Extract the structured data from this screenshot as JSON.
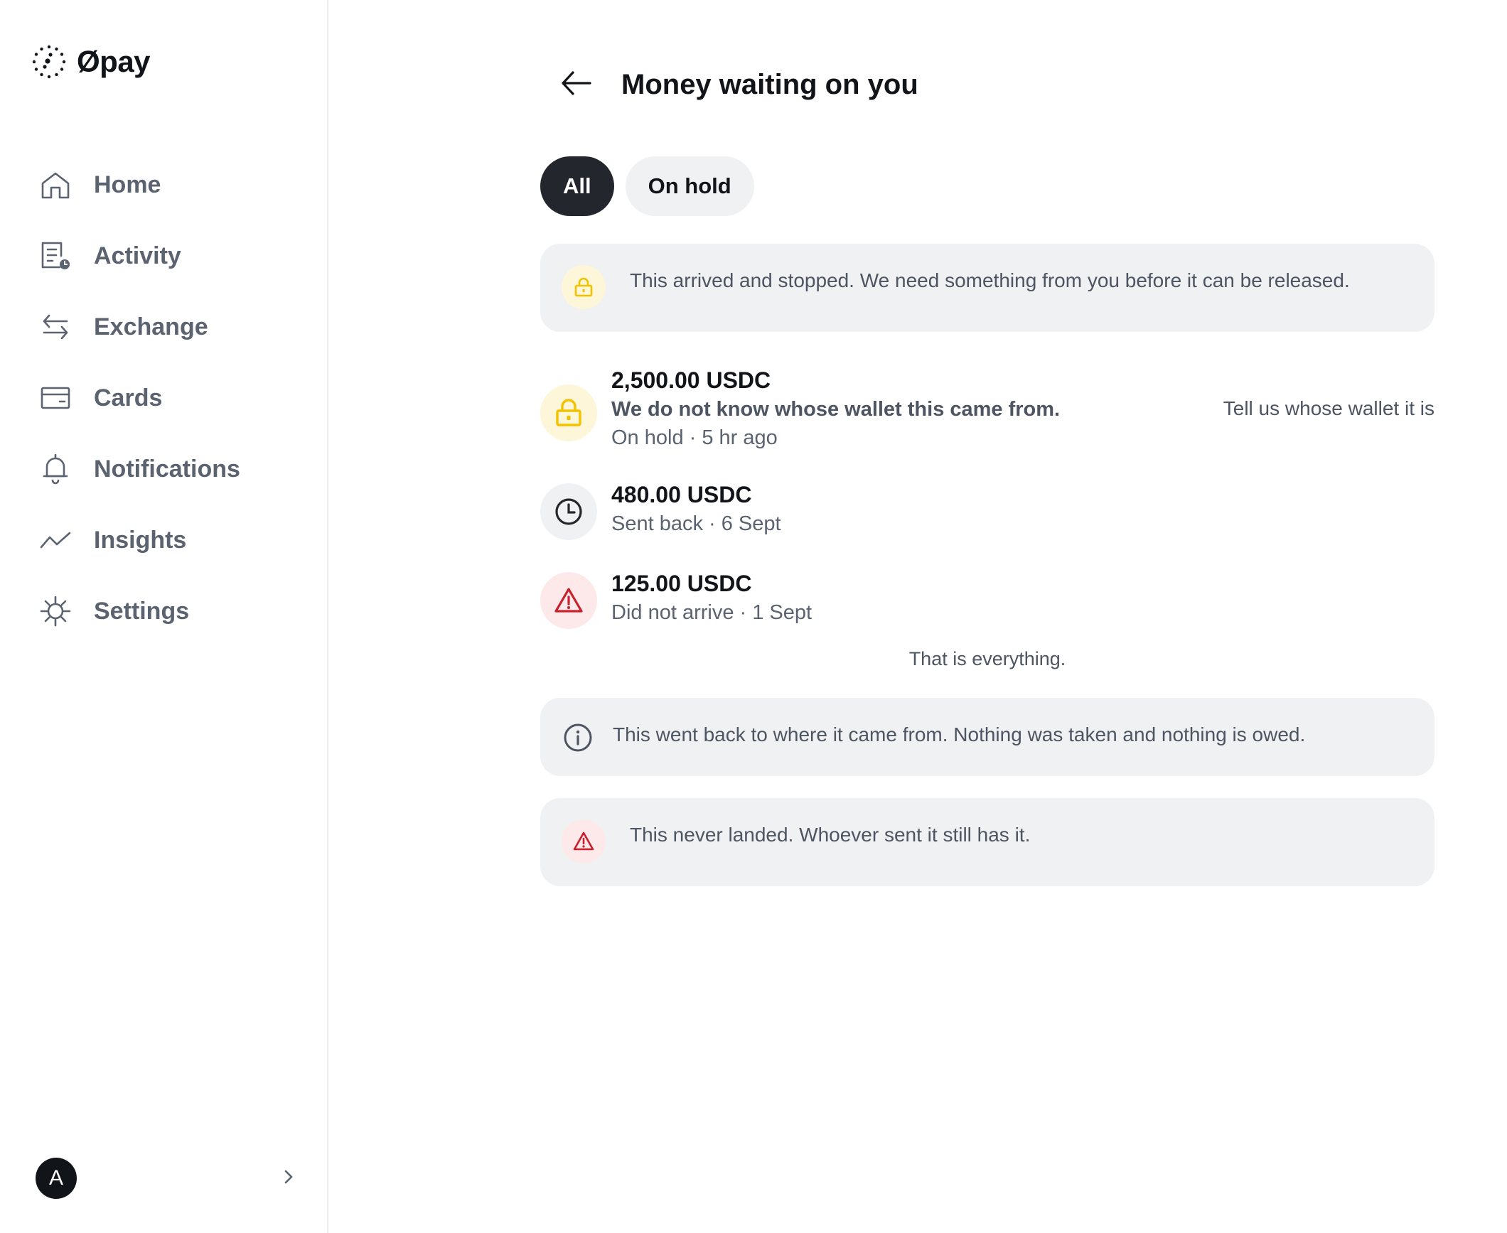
{
  "brand": {
    "name": "Øpay"
  },
  "sidebar": {
    "items": [
      {
        "label": "Home",
        "icon": "home-icon"
      },
      {
        "label": "Activity",
        "icon": "activity-icon"
      },
      {
        "label": "Exchange",
        "icon": "exchange-icon"
      },
      {
        "label": "Cards",
        "icon": "card-icon"
      },
      {
        "label": "Notifications",
        "icon": "bell-icon"
      },
      {
        "label": "Insights",
        "icon": "trend-icon"
      },
      {
        "label": "Settings",
        "icon": "gear-icon"
      }
    ],
    "account": {
      "avatar_letter": "A"
    }
  },
  "page": {
    "title": "Money waiting on you"
  },
  "tabs": [
    {
      "label": "All",
      "active": true
    },
    {
      "label": "On hold",
      "active": false
    }
  ],
  "top_banner": {
    "text": "This arrived and stopped. We need something from you before it can be released."
  },
  "items": [
    {
      "amount": "2,500.00 USDC",
      "reason": "We do not know whose wallet this came from.",
      "meta": "On hold · 5 hr ago",
      "action": "Tell us whose wallet it is",
      "icon": "lock-icon"
    },
    {
      "amount": "480.00 USDC",
      "meta": "Sent back · 6 Sept",
      "icon": "clock-icon"
    },
    {
      "amount": "125.00 USDC",
      "meta": "Did not arrive · 1 Sept",
      "icon": "warning-icon"
    }
  ],
  "end_text": "That is everything.",
  "info_banner": {
    "text": "This went back to where it came from. Nothing was taken and nothing is owed."
  },
  "warning_banner": {
    "text": "This never landed. Whoever sent it still has it."
  },
  "colors": {
    "accent_yellow": "#f2c200",
    "yellow_bg": "#fdf6d8",
    "danger_red": "#c8202c",
    "danger_bg": "#fde9ea",
    "neutral_bg": "#f0f1f3",
    "dark": "#23272d"
  }
}
